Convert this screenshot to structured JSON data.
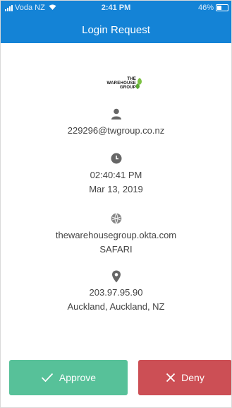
{
  "status_bar": {
    "carrier": "Voda NZ",
    "time": "2:41 PM",
    "battery": "46%",
    "battery_level": 0.46
  },
  "header": {
    "title": "Login Request"
  },
  "logo": {
    "line1": "THE",
    "line2": "WAREHOUSE",
    "line3": "GROUP"
  },
  "user": {
    "icon": "user-icon",
    "email": "229296@twgroup.co.nz"
  },
  "time_info": {
    "icon": "clock-icon",
    "time": "02:40:41 PM",
    "date": "Mar 13, 2019"
  },
  "app_info": {
    "icon": "globe-icon",
    "domain": "thewarehousegroup.okta.com",
    "browser": "SAFARI"
  },
  "location_info": {
    "icon": "location-pin-icon",
    "ip": "203.97.95.90",
    "location": "Auckland, Auckland, NZ"
  },
  "actions": {
    "approve_label": "Approve",
    "deny_label": "Deny",
    "approve_color": "#57c199",
    "deny_color": "#cc4f55"
  },
  "colors": {
    "header": "#1483d6",
    "text": "#444444",
    "icon": "#666666"
  }
}
